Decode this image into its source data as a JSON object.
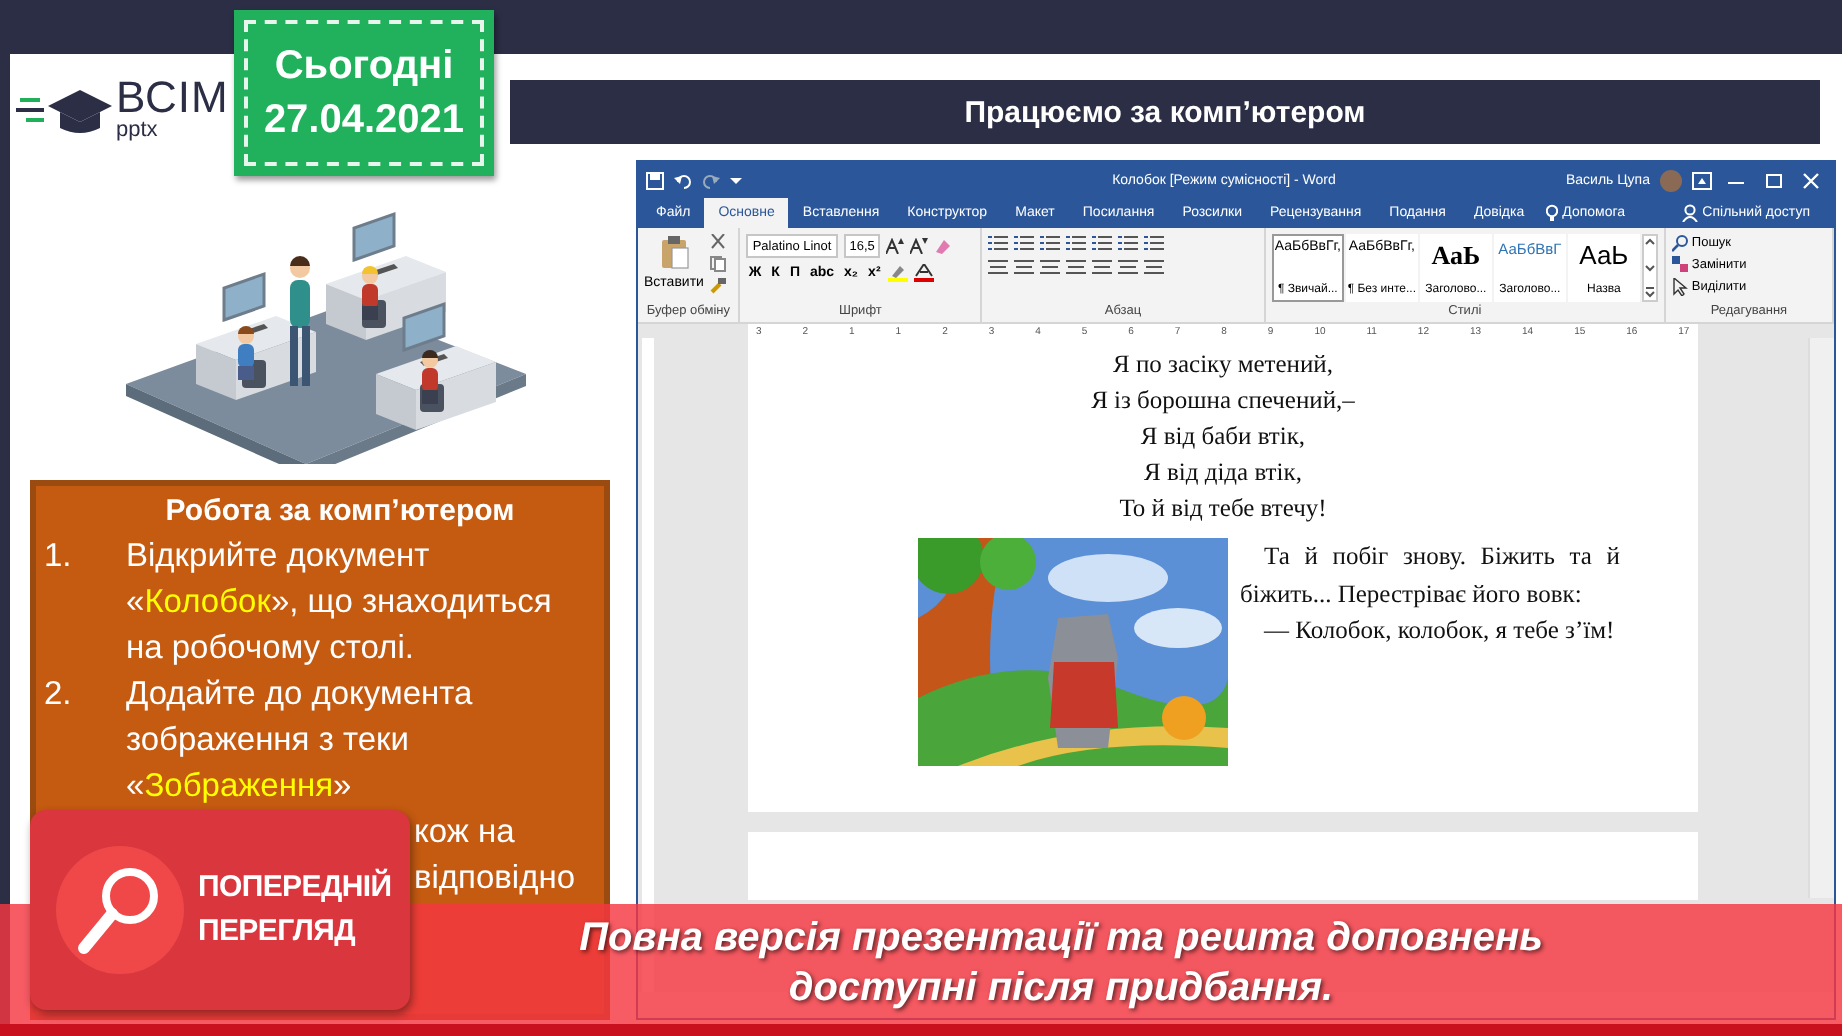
{
  "logo": {
    "title": "ВСІМ",
    "subtitle": "pptx"
  },
  "date_tag": {
    "label": "Сьогодні",
    "date": "27.04.2021"
  },
  "title": "Працюємо за комп’ютером",
  "task": {
    "heading": "Робота за комп’ютером",
    "steps": [
      {
        "number": "1.",
        "parts": [
          {
            "text": "Відкрийте документ «",
            "highlight": false
          },
          {
            "text": "Колобок",
            "highlight": true
          },
          {
            "text": "», що знаходиться на робочому столі.",
            "highlight": false
          }
        ]
      },
      {
        "number": "2.",
        "parts": [
          {
            "text": "Додайте до документа зображення з теки «",
            "highlight": false
          },
          {
            "text": "Зображення",
            "highlight": true
          },
          {
            "text": "»",
            "highlight": false
          }
        ]
      }
    ],
    "cut_lines": [
      {
        "parts": [
          {
            "text": "кож на",
            "highlight": false
          }
        ]
      },
      {
        "parts": [
          {
            "text": "відповідно",
            "highlight": false
          }
        ]
      }
    ]
  },
  "word": {
    "title": "Колобок [Режим сумісності] - Word",
    "user": "Василь Цупа",
    "tabs": [
      {
        "label": "Файл",
        "selected": false
      },
      {
        "label": "Основне",
        "selected": true
      },
      {
        "label": "Вставлення",
        "selected": false
      },
      {
        "label": "Конструктор",
        "selected": false
      },
      {
        "label": "Макет",
        "selected": false
      },
      {
        "label": "Посилання",
        "selected": false
      },
      {
        "label": "Розсилки",
        "selected": false
      },
      {
        "label": "Рецензування",
        "selected": false
      },
      {
        "label": "Подання",
        "selected": false
      },
      {
        "label": "Довідка",
        "selected": false
      }
    ],
    "help": "Допомога",
    "share": "Спільний доступ",
    "ribbon": {
      "paste": "Вставити",
      "clipboard_group": "Буфер обміну",
      "font": "Palatino Linot",
      "size": "16,5",
      "format_buttons": [
        "Ж",
        "К",
        "П",
        "abc",
        "x₂",
        "x²"
      ],
      "font_group": "Шрифт",
      "paragraph_group": "Абзац",
      "styles": [
        {
          "sample": "АаБбВвГг,",
          "name": "¶ Звичай...",
          "kind": "normal",
          "selected": true
        },
        {
          "sample": "АаБбВвГг,",
          "name": "¶ Без инте...",
          "kind": "normal",
          "selected": false
        },
        {
          "sample": "АаЬ",
          "name": "Заголово...",
          "kind": "heading1",
          "selected": false
        },
        {
          "sample": "АаБбВвГ",
          "name": "Заголово...",
          "kind": "heading2",
          "selected": false
        },
        {
          "sample": "АаЬ",
          "name": "Назва",
          "kind": "title",
          "selected": false
        }
      ],
      "styles_group": "Стилі",
      "editing": [
        "Пошук",
        "Замінити",
        "Виділити"
      ],
      "editing_group": "Редагування"
    },
    "ruler": [
      "3",
      "2",
      "1",
      "1",
      "2",
      "3",
      "4",
      "5",
      "6",
      "7",
      "8",
      "9",
      "10",
      "11",
      "12",
      "13",
      "14",
      "15",
      "16",
      "17"
    ],
    "page": {
      "poem": [
        "Я по засіку метений,",
        "Я із борошна спечений,–",
        "Я від баби втік,",
        "Я від діда втік,",
        "То й від тебе втечу!"
      ],
      "paragraphs": [
        "Та й побіг знову. Біжить та й біжить... Перестріває його вовк:",
        "— Колобок, колобок, я тебе з’їм!"
      ]
    }
  },
  "banner": {
    "badge": [
      "ПОПЕРЕДНІЙ",
      "ПЕРЕГЛЯД"
    ],
    "message": [
      "Повна версія презентації та решта доповнень",
      "доступні після придбання."
    ]
  }
}
